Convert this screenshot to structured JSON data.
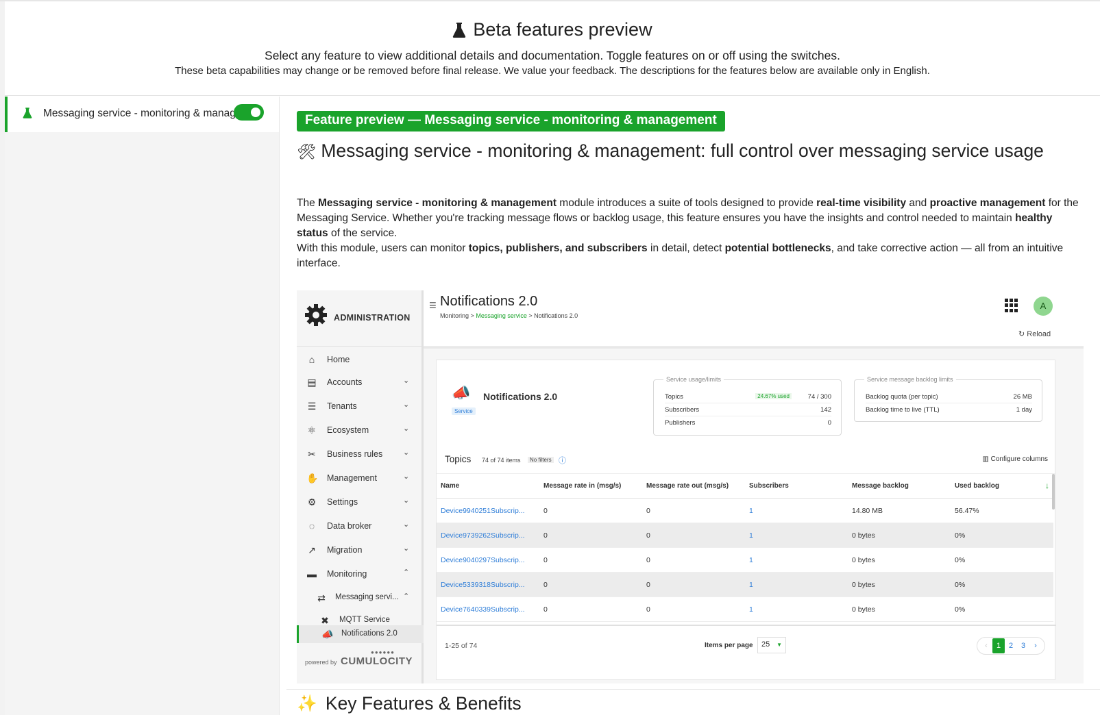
{
  "header": {
    "title": "Beta features preview",
    "title_icon": "flask-icon",
    "subtitle": "Select any feature to view additional details and documentation. Toggle features on or off using the switches.",
    "note": "These beta capabilities may change or be removed before final release. We value your feedback. The descriptions for the features below are available only in English."
  },
  "sidebar": {
    "items": [
      {
        "label": "Messaging service - monitoring & management",
        "enabled": true,
        "icon": "flask-icon"
      }
    ]
  },
  "main": {
    "badge": "Feature preview — Messaging service - monitoring & management",
    "heading_icon": "tools-icon",
    "heading": "Messaging service - monitoring & management: full control over messaging service usage",
    "para1": {
      "t1": "The ",
      "b1": "Messaging service - monitoring & management",
      "t2": " module introduces a suite of tools designed to provide ",
      "b2": "real-time visibility",
      "t3": " and ",
      "b3": "proactive management",
      "t4": " for the Messaging Service. Whether you're tracking message flows or backlog usage, this feature ensures you have the insights and control needed to maintain ",
      "b4": "healthy status",
      "t5": " of the service."
    },
    "para2": {
      "t1": "With this module, users can monitor ",
      "b1": "topics, publishers, and subscribers",
      "t2": " in detail, detect ",
      "b2": "potential bottlenecks",
      "t3": ", and take corrective action — all from an intuitive interface."
    },
    "next_section": "Key Features & Benefits",
    "next_section_icon": "sparkles-icon"
  },
  "screenshot": {
    "brand": "ADMINISTRATION",
    "nav": [
      {
        "label": "Home",
        "icon": "home-icon",
        "chevron": ""
      },
      {
        "label": "Accounts",
        "icon": "accounts-icon",
        "chevron": "⌄"
      },
      {
        "label": "Tenants",
        "icon": "tenants-icon",
        "chevron": "⌄"
      },
      {
        "label": "Ecosystem",
        "icon": "ecosystem-icon",
        "chevron": "⌄"
      },
      {
        "label": "Business rules",
        "icon": "business-rules-icon",
        "chevron": "⌄"
      },
      {
        "label": "Management",
        "icon": "management-icon",
        "chevron": "⌄"
      },
      {
        "label": "Settings",
        "icon": "settings-icon",
        "chevron": "⌄"
      },
      {
        "label": "Data broker",
        "icon": "data-broker-icon",
        "chevron": "⌄"
      },
      {
        "label": "Migration",
        "icon": "migration-icon",
        "chevron": "⌄"
      },
      {
        "label": "Monitoring",
        "icon": "monitoring-icon",
        "chevron": "⌃"
      },
      {
        "label": "Messaging servi...",
        "icon": "messaging-icon",
        "chevron": "⌃"
      },
      {
        "label": "MQTT Service",
        "icon": "mqtt-icon",
        "chevron": ""
      },
      {
        "label": "Notifications 2.0",
        "icon": "notifications-icon",
        "chevron": ""
      }
    ],
    "powered_by": "powered by",
    "powered_brand": "CUMULOCITY",
    "page_title": "Notifications 2.0",
    "breadcrumb": {
      "a": "Monitoring",
      "sep1": ">",
      "b": "Messaging service",
      "sep2": ">",
      "c": "Notifications 2.0"
    },
    "avatar": "A",
    "reload": "Reload",
    "service": {
      "name": "Notifications 2.0",
      "tag": "Service",
      "usage_legend": "Service usage/limits",
      "usage": [
        {
          "k": "Topics",
          "v": "74 / 300",
          "pct": "24.67% used"
        },
        {
          "k": "Subscribers",
          "v": "142",
          "pct": ""
        },
        {
          "k": "Publishers",
          "v": "0",
          "pct": ""
        }
      ],
      "backlog_legend": "Service message backlog limits",
      "backlog": [
        {
          "k": "Backlog quota (per topic)",
          "v": "26 MB"
        },
        {
          "k": "Backlog time to live (TTL)",
          "v": "1 day"
        }
      ]
    },
    "topics": {
      "title": "Topics",
      "count": "74 of 74 items",
      "filters": "No filters",
      "configure": "Configure columns",
      "columns": [
        "Name",
        "Message rate in (msg/s)",
        "Message rate out (msg/s)",
        "Subscribers",
        "Message backlog",
        "Used backlog"
      ],
      "rows": [
        [
          "Device9940251Subscrip...",
          "0",
          "0",
          "1",
          "14.80 MB",
          "56.47%"
        ],
        [
          "Device9739262Subscrip...",
          "0",
          "0",
          "1",
          "0 bytes",
          "0%"
        ],
        [
          "Device9040297Subscrip...",
          "0",
          "0",
          "1",
          "0 bytes",
          "0%"
        ],
        [
          "Device5339318Subscrip...",
          "0",
          "0",
          "1",
          "0 bytes",
          "0%"
        ],
        [
          "Device7640339Subscrip...",
          "0",
          "0",
          "1",
          "0 bytes",
          "0%"
        ]
      ]
    },
    "pagination": {
      "range": "1-25 of 74",
      "items_per_page_label": "Items per page",
      "items_per_page": "25",
      "prev": "‹",
      "pages": [
        "1",
        "2",
        "3"
      ],
      "current": "1",
      "next": "›"
    }
  },
  "colors": {
    "accent": "#1aa32b",
    "link": "#2f7ed8"
  }
}
